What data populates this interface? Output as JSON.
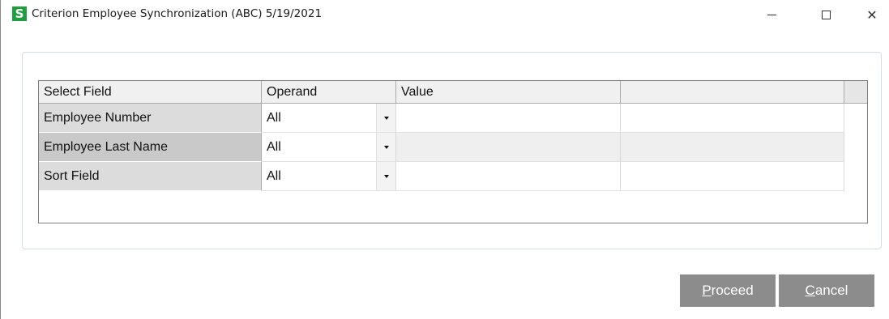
{
  "window": {
    "title": "Criterion Employee Synchronization (ABC) 5/19/2021",
    "icon_letter": "S",
    "icon_color": "#1e9e3e"
  },
  "titlebar_buttons": {
    "minimize_icon": "minimize-icon",
    "maximize_icon": "maximize-icon",
    "close_icon": "close-icon",
    "close_glyph": "✕"
  },
  "grid": {
    "headers": [
      "Select Field",
      "Operand",
      "Value",
      ""
    ],
    "rows": [
      {
        "field": "Employee Number",
        "operand": "All",
        "value": "",
        "extra": ""
      },
      {
        "field": "Employee Last Name",
        "operand": "All",
        "value": "",
        "extra": ""
      },
      {
        "field": "Sort Field",
        "operand": "All",
        "value": "",
        "extra": ""
      }
    ]
  },
  "buttons": {
    "proceed_first": "P",
    "proceed_rest": "roceed",
    "cancel_first": "C",
    "cancel_rest": "ancel",
    "color": "#8c8c8c"
  }
}
